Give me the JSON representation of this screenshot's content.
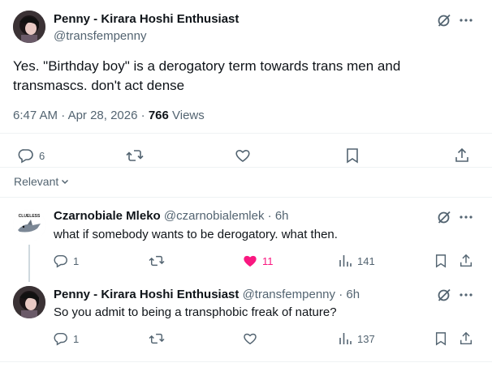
{
  "main_tweet": {
    "author_name": "Penny - Kirara Hoshi Enthusiast",
    "handle": "@transfempenny",
    "text_line1": "Yes. \"Birthday boy\" is a derogatory term towards trans men and",
    "text_line2": "transmascs. don't act dense",
    "time": "6:47 AM",
    "date": "Apr 28, 2026",
    "separator": "·",
    "views_count": "766",
    "views_label": "Views",
    "replies": "6"
  },
  "replies_filter": {
    "label": "Relevant"
  },
  "replies": [
    {
      "author_name": "Czarnobiale Mleko",
      "handle": "@czarnobialemlek",
      "time": "6h",
      "text": "what if somebody wants to be derogatory. what then.",
      "reply_count": "1",
      "like_count": "11",
      "views": "141",
      "avatar_text": "CLUELESS"
    },
    {
      "author_name": "Penny - Kirara Hoshi Enthusiast",
      "handle": "@transfempenny",
      "time": "6h",
      "text": "So you admit to being a transphobic freak of nature?",
      "reply_count": "1",
      "views": "137"
    }
  ],
  "colors": {
    "text": "#0f1419",
    "muted": "#536471",
    "like_active": "#f91880",
    "divider": "#eff3f4"
  },
  "icons": [
    "grok-icon",
    "more-icon",
    "reply-icon",
    "retweet-icon",
    "like-icon",
    "bookmark-icon",
    "share-icon",
    "views-icon",
    "chevron-down-icon"
  ]
}
